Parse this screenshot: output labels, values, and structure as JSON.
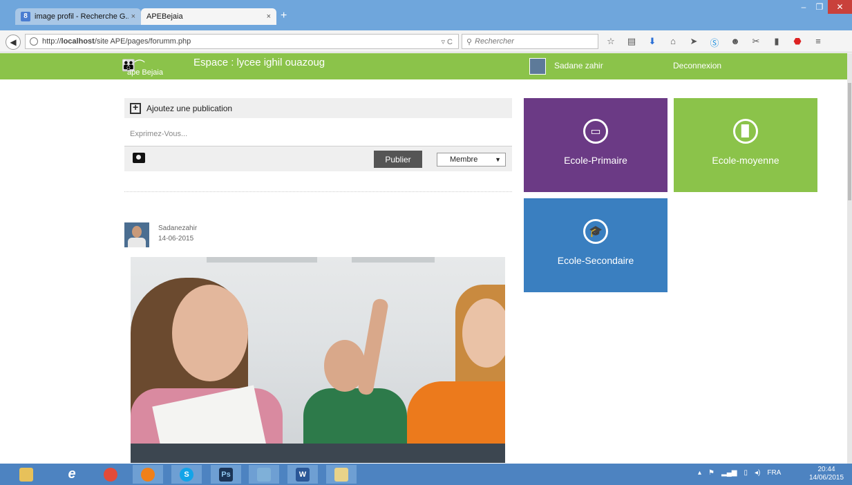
{
  "browser": {
    "tabs": [
      {
        "label": "image profil - Recherche G...",
        "active": false
      },
      {
        "label": "APEBejaia",
        "active": true
      }
    ],
    "tab_close": "×",
    "new_tab": "+",
    "window_controls": {
      "minimize": "–",
      "maximize": "❐",
      "close": "✕"
    },
    "url_prefix": "http://",
    "url_host": "localhost",
    "url_path": "/site APE/pages/forumm.php",
    "url_reload": "▿ C",
    "search_placeholder": "Rechercher"
  },
  "header": {
    "logo_text": "ape Bejaia",
    "space_title": "Espace : lycee ighil ouazoug",
    "user_name": "Sadane zahir",
    "logout": "Deconnexion"
  },
  "publish": {
    "title": "Ajoutez une publication",
    "placeholder": "Exprimez-Vous...",
    "publish_button": "Publier",
    "audience_selected": "Membre"
  },
  "post": {
    "author": "Sadanezahir",
    "date": "14-06-2015"
  },
  "tiles": [
    {
      "label": "Ecole-Primaire",
      "color": "#6b3a85",
      "icon": "tablet-icon"
    },
    {
      "label": "Ecole-moyenne",
      "color": "#8bc34a",
      "icon": "book-icon"
    },
    {
      "label": "Ecole-Secondaire",
      "color": "#3a7fc0",
      "icon": "graduation-cap-icon"
    }
  ],
  "taskbar": {
    "apps": [
      "file-explorer-icon",
      "internet-explorer-icon",
      "chrome-icon",
      "firefox-icon",
      "skype-icon",
      "photoshop-icon",
      "photo-viewer-icon",
      "word-icon",
      "paint-icon"
    ],
    "photoshop_label": "Ps",
    "word_label": "W",
    "language": "FRA",
    "time": "20:44",
    "date": "14/06/2015"
  },
  "colors": {
    "header_green": "#8bc34a",
    "titlebar_blue": "#6fa6dc",
    "taskbar_blue": "#4d83c1"
  }
}
